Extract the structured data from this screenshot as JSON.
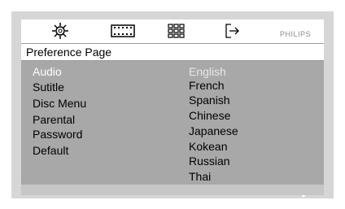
{
  "header": {
    "icons": [
      "gear-icon",
      "film-icon",
      "grid-icon",
      "exit-icon"
    ],
    "brand": "PHILIPS"
  },
  "page": {
    "title": "Preference Page"
  },
  "menu": {
    "items": [
      "Audio",
      "Sutitle",
      "Disc Menu",
      "Parental",
      "Password",
      "Default"
    ],
    "selected": "Audio"
  },
  "options": {
    "items": [
      "English",
      "French",
      "Spanish",
      "Chinese",
      "Japanese",
      "Kokean",
      "Russian",
      "Thai"
    ],
    "highlighted": "English"
  },
  "colors": {
    "panel": "#a8a8a8",
    "frame": "#d6d6d6",
    "selected_text": "#ffffff"
  }
}
